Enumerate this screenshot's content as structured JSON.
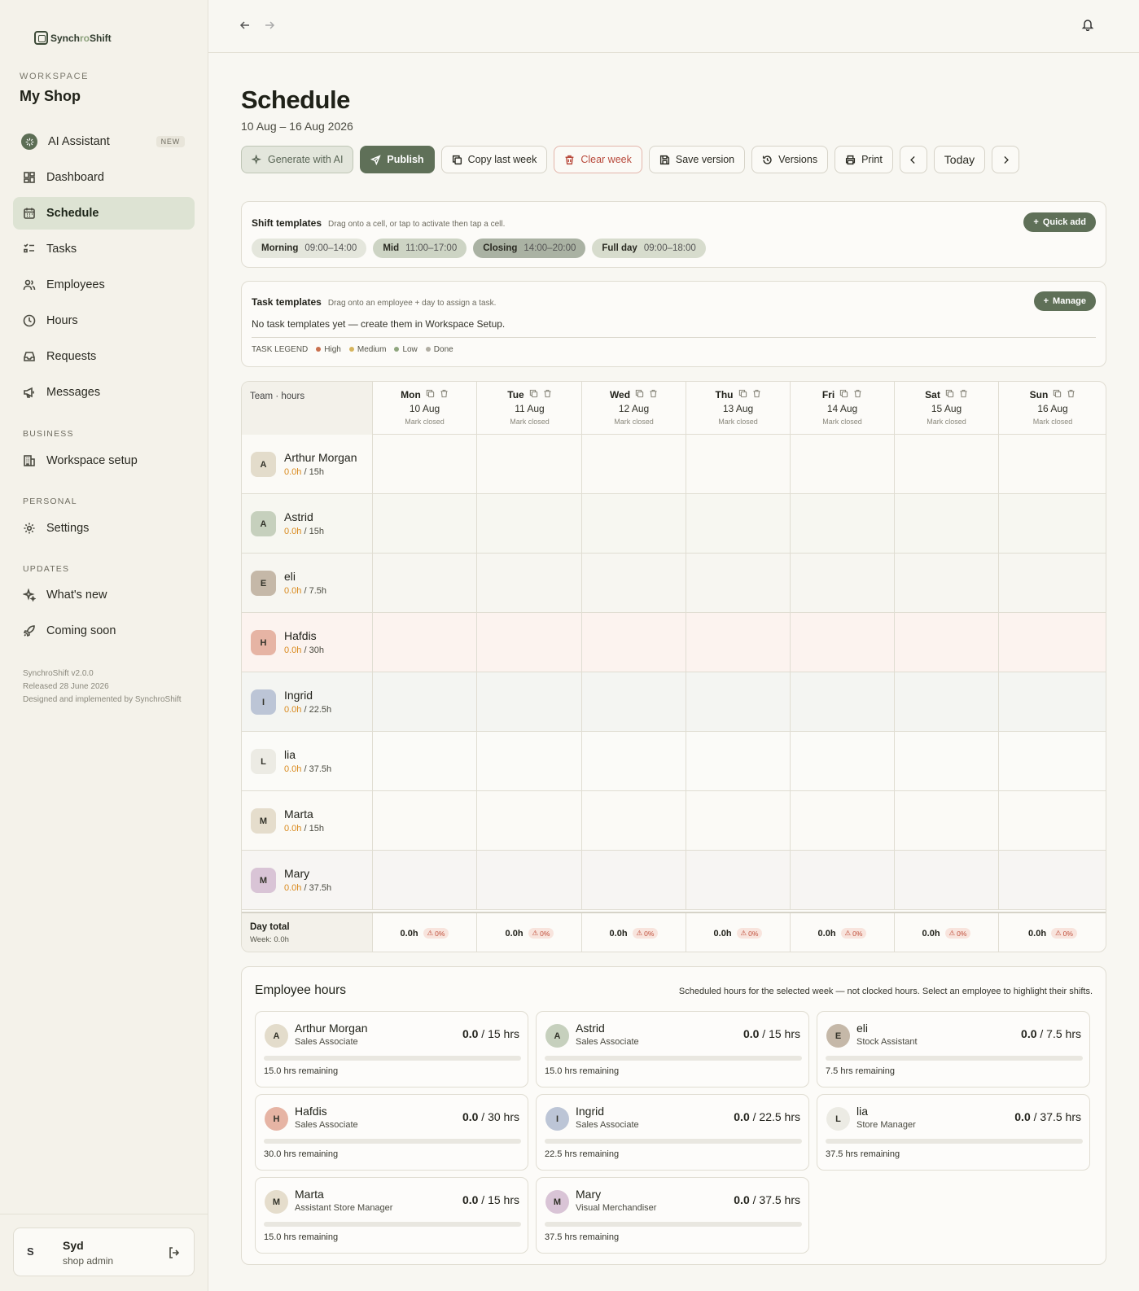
{
  "brand": {
    "name_prefix": "Synch",
    "name_accent": "ro",
    "name_suffix": "Shift"
  },
  "workspace": {
    "label": "WORKSPACE",
    "name": "My Shop"
  },
  "nav": {
    "ai": {
      "label": "AI Assistant",
      "badge": "NEW"
    },
    "items": [
      {
        "label": "Dashboard",
        "icon": "dashboard-icon"
      },
      {
        "label": "Schedule",
        "icon": "calendar-icon"
      },
      {
        "label": "Tasks",
        "icon": "tasks-icon"
      },
      {
        "label": "Employees",
        "icon": "users-icon"
      },
      {
        "label": "Hours",
        "icon": "clock-icon"
      },
      {
        "label": "Requests",
        "icon": "inbox-icon"
      },
      {
        "label": "Messages",
        "icon": "megaphone-icon"
      }
    ],
    "business_label": "BUSINESS",
    "business_items": [
      {
        "label": "Workspace setup",
        "icon": "building-icon"
      }
    ],
    "personal_label": "PERSONAL",
    "personal_items": [
      {
        "label": "Settings",
        "icon": "gear-icon"
      }
    ],
    "updates_label": "UPDATES",
    "updates_items": [
      {
        "label": "What's new",
        "icon": "sparkle-icon"
      },
      {
        "label": "Coming soon",
        "icon": "rocket-icon"
      }
    ]
  },
  "version": {
    "line1": "SynchroShift v2.0.0",
    "line2": "Released 28 June 2026",
    "line3": "Designed and implemented by SynchroShift"
  },
  "user": {
    "initial": "S",
    "name": "Syd",
    "role": "shop admin"
  },
  "page": {
    "title": "Schedule",
    "date_range": "10 Aug – 16 Aug 2026"
  },
  "toolbar": {
    "generate": "Generate with AI",
    "publish": "Publish",
    "copy": "Copy last week",
    "clear": "Clear week",
    "save": "Save version",
    "versions": "Versions",
    "print": "Print",
    "today": "Today"
  },
  "shift_templates": {
    "title": "Shift templates",
    "hint": "Drag onto a cell, or tap to activate then tap a cell.",
    "quick_add": "Quick add",
    "items": [
      {
        "name": "Morning",
        "time": "09:00–14:00",
        "color": "#e4e6dc"
      },
      {
        "name": "Mid",
        "time": "11:00–17:00",
        "color": "#cdd4c4"
      },
      {
        "name": "Closing",
        "time": "14:00–20:00",
        "color": "#aab2a3"
      },
      {
        "name": "Full day",
        "time": "09:00–18:00",
        "color": "#d7dccd"
      }
    ]
  },
  "task_templates": {
    "title": "Task templates",
    "hint": "Drag onto an employee + day to assign a task.",
    "manage": "Manage",
    "empty": "No task templates yet — create them in Workspace Setup.",
    "legend_label": "TASK LEGEND",
    "legend": [
      {
        "label": "High",
        "color": "#c9704e"
      },
      {
        "label": "Medium",
        "color": "#d6b45c"
      },
      {
        "label": "Low",
        "color": "#8fa67e"
      },
      {
        "label": "Done",
        "color": "#b0ada2"
      }
    ]
  },
  "grid": {
    "first_header": "Team · hours",
    "days": [
      {
        "name": "Mon",
        "date": "10 Aug",
        "status": "Mark closed"
      },
      {
        "name": "Tue",
        "date": "11 Aug",
        "status": "Mark closed"
      },
      {
        "name": "Wed",
        "date": "12 Aug",
        "status": "Mark closed"
      },
      {
        "name": "Thu",
        "date": "13 Aug",
        "status": "Mark closed"
      },
      {
        "name": "Fri",
        "date": "14 Aug",
        "status": "Mark closed"
      },
      {
        "name": "Sat",
        "date": "15 Aug",
        "status": "Mark closed"
      },
      {
        "name": "Sun",
        "date": "16 Aug",
        "status": "Mark closed"
      }
    ],
    "employees": [
      {
        "initial": "A",
        "name": "Arthur Morgan",
        "scheduled": "0.0h",
        "target": "/ 15h",
        "color": "#e3dccb",
        "row_bg": "#fbfaf6"
      },
      {
        "initial": "A",
        "name": "Astrid",
        "scheduled": "0.0h",
        "target": "/ 15h",
        "color": "#c6d0bd",
        "row_bg": "#f7f7f1"
      },
      {
        "initial": "E",
        "name": "eli",
        "scheduled": "0.0h",
        "target": "/ 7.5h",
        "color": "#c5b8a8",
        "row_bg": "#f7f6f1"
      },
      {
        "initial": "H",
        "name": "Hafdis",
        "scheduled": "0.0h",
        "target": "/ 30h",
        "color": "#e6b4a4",
        "row_bg": "#fcf3ef"
      },
      {
        "initial": "I",
        "name": "Ingrid",
        "scheduled": "0.0h",
        "target": "/ 22.5h",
        "color": "#bcc5d6",
        "row_bg": "#f4f5f2"
      },
      {
        "initial": "L",
        "name": "lia",
        "scheduled": "0.0h",
        "target": "/ 37.5h",
        "color": "#ecebe4",
        "row_bg": "#fbfbf8"
      },
      {
        "initial": "M",
        "name": "Marta",
        "scheduled": "0.0h",
        "target": "/ 15h",
        "color": "#e5ddcc",
        "row_bg": "#fbfaf6"
      },
      {
        "initial": "M",
        "name": "Mary",
        "scheduled": "0.0h",
        "target": "/ 37.5h",
        "color": "#d9c4d6",
        "row_bg": "#f7f5f3"
      }
    ],
    "total_label": "Day total",
    "week_total": "Week: 0.0h",
    "day_totals": [
      {
        "hours": "0.0h",
        "coverage": "0%"
      },
      {
        "hours": "0.0h",
        "coverage": "0%"
      },
      {
        "hours": "0.0h",
        "coverage": "0%"
      },
      {
        "hours": "0.0h",
        "coverage": "0%"
      },
      {
        "hours": "0.0h",
        "coverage": "0%"
      },
      {
        "hours": "0.0h",
        "coverage": "0%"
      },
      {
        "hours": "0.0h",
        "coverage": "0%"
      }
    ]
  },
  "employee_hours": {
    "title": "Employee hours",
    "hint": "Scheduled hours for the selected week — not clocked hours. Select an employee to highlight their shifts.",
    "cards": [
      {
        "initial": "A",
        "name": "Arthur Morgan",
        "role": "Sales Associate",
        "scheduled": "0.0",
        "target": "/ 15 hrs",
        "remaining": "15.0 hrs remaining",
        "progress": 0,
        "color": "#e3dccb"
      },
      {
        "initial": "A",
        "name": "Astrid",
        "role": "Sales Associate",
        "scheduled": "0.0",
        "target": "/ 15 hrs",
        "remaining": "15.0 hrs remaining",
        "progress": 0,
        "color": "#c6d0bd"
      },
      {
        "initial": "E",
        "name": "eli",
        "role": "Stock Assistant",
        "scheduled": "0.0",
        "target": "/ 7.5 hrs",
        "remaining": "7.5 hrs remaining",
        "progress": 0,
        "color": "#c5b8a8"
      },
      {
        "initial": "H",
        "name": "Hafdis",
        "role": "Sales Associate",
        "scheduled": "0.0",
        "target": "/ 30 hrs",
        "remaining": "30.0 hrs remaining",
        "progress": 0,
        "color": "#e6b4a4"
      },
      {
        "initial": "I",
        "name": "Ingrid",
        "role": "Sales Associate",
        "scheduled": "0.0",
        "target": "/ 22.5 hrs",
        "remaining": "22.5 hrs remaining",
        "progress": 0,
        "color": "#bcc5d6"
      },
      {
        "initial": "L",
        "name": "lia",
        "role": "Store Manager",
        "scheduled": "0.0",
        "target": "/ 37.5 hrs",
        "remaining": "37.5 hrs remaining",
        "progress": 0,
        "color": "#ecebe4"
      },
      {
        "initial": "M",
        "name": "Marta",
        "role": "Assistant Store Manager",
        "scheduled": "0.0",
        "target": "/ 15 hrs",
        "remaining": "15.0 hrs remaining",
        "progress": 0,
        "color": "#e5ddcc"
      },
      {
        "initial": "M",
        "name": "Mary",
        "role": "Visual Merchandiser",
        "scheduled": "0.0",
        "target": "/ 37.5 hrs",
        "remaining": "37.5 hrs remaining",
        "progress": 0,
        "color": "#d9c4d6"
      }
    ]
  }
}
